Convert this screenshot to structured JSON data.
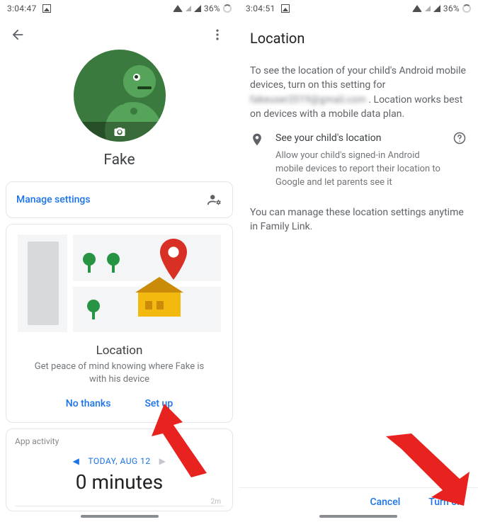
{
  "screen1": {
    "status": {
      "time": "3:04:47",
      "battery": "36%"
    },
    "profile": {
      "name": "Fake",
      "camera_icon": "camera-icon"
    },
    "manage": {
      "label": "Manage settings",
      "icon": "people-gear-icon"
    },
    "location_card": {
      "title": "Location",
      "subtitle": "Get peace of mind knowing where Fake is with his device",
      "no_thanks": "No thanks",
      "set_up": "Set up"
    },
    "activity_card": {
      "label": "App activity",
      "nav_prev": "◀",
      "date": "TODAY, AUG 12",
      "nav_next": "▶",
      "value": "0 minutes",
      "axis_tick": "2m"
    }
  },
  "screen2": {
    "status": {
      "time": "3:04:51",
      "battery": "36%"
    },
    "title": "Location",
    "para1_a": "To see the location of your child's Android mobile devices, turn on this setting for ",
    "para1_blur": "fakeuser2019@gmail.com",
    "para1_b": ". Location works best on devices with a mobile data plan.",
    "note": {
      "title": "See your child's location",
      "desc": "Allow your child's signed-in Android mobile devices to report their location to Google and let parents see it"
    },
    "para2": "You can manage these location settings anytime in Family Link.",
    "cancel": "Cancel",
    "turn_on": "Turn on"
  }
}
